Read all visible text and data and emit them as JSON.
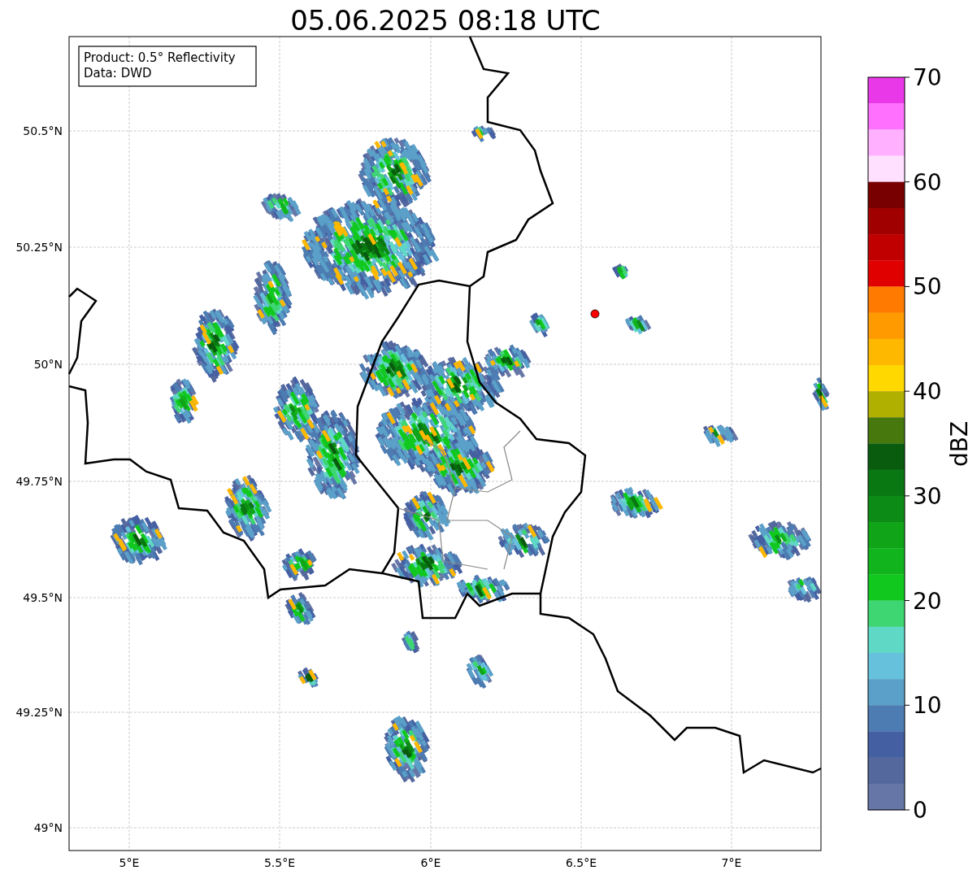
{
  "title": "05.06.2025 08:18 UTC",
  "legend": [
    "Product: 0.5° Reflectivity",
    "Data: DWD"
  ],
  "x_ticks": [
    "5°E",
    "5.5°E",
    "6°E",
    "6.5°E",
    "7°E"
  ],
  "y_ticks": [
    "50.5°N",
    "50.25°N",
    "50°N",
    "49.75°N",
    "49.5°N",
    "49.25°N",
    "49°N"
  ],
  "colorbar": {
    "label": "dBZ",
    "ticks": [
      "70",
      "60",
      "50",
      "40",
      "30",
      "20",
      "10",
      "0"
    ],
    "segments": [
      {
        "color": "#e838e8"
      },
      {
        "color": "#ff70ff"
      },
      {
        "color": "#ffb0ff"
      },
      {
        "color": "#ffe0ff"
      },
      {
        "color": "#780000"
      },
      {
        "color": "#a00000"
      },
      {
        "color": "#c00000"
      },
      {
        "color": "#e00000"
      },
      {
        "color": "#ff7a00"
      },
      {
        "color": "#ff9a00"
      },
      {
        "color": "#ffb800"
      },
      {
        "color": "#ffd800"
      },
      {
        "color": "#b0b000"
      },
      {
        "color": "#46780e"
      },
      {
        "color": "#095c0e"
      },
      {
        "color": "#0a7812"
      },
      {
        "color": "#0c8c16"
      },
      {
        "color": "#10a418"
      },
      {
        "color": "#12b41e"
      },
      {
        "color": "#10c81e"
      },
      {
        "color": "#3ed672"
      },
      {
        "color": "#5fd8c6"
      },
      {
        "color": "#66c2dc"
      },
      {
        "color": "#5aa0c8"
      },
      {
        "color": "#4c7cb2"
      },
      {
        "color": "#4560a2"
      },
      {
        "color": "#54689e"
      },
      {
        "color": "#6676a6"
      }
    ]
  }
}
